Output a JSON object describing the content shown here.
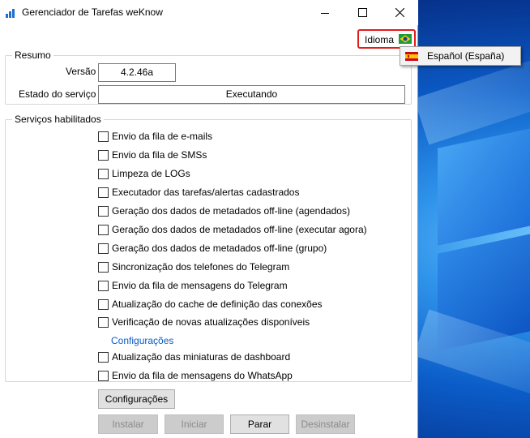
{
  "window": {
    "title": "Gerenciador de Tarefas weKnow",
    "minimize_icon": "minimize-icon",
    "maximize_icon": "maximize-icon",
    "close_icon": "close-icon"
  },
  "language": {
    "label": "Idioma",
    "current_flag": "brazil-flag-icon",
    "menu": {
      "items": [
        {
          "label": "Español (España)",
          "flag": "spain-flag-icon"
        }
      ]
    }
  },
  "summary": {
    "title": "Resumo",
    "version_label": "Versão",
    "version_value": "4.2.46a",
    "status_label": "Estado do serviço",
    "status_value": "Executando"
  },
  "services": {
    "title": "Serviços habilitados",
    "items": [
      {
        "label": "Envio da fila de e-mails",
        "checked": false
      },
      {
        "label": "Envio da fila de SMSs",
        "checked": false
      },
      {
        "label": "Limpeza de LOGs",
        "checked": false
      },
      {
        "label": "Executador das tarefas/alertas cadastrados",
        "checked": false
      },
      {
        "label": "Geração dos dados de metadados off-line (agendados)",
        "checked": false
      },
      {
        "label": "Geração dos dados de metadados off-line (executar agora)",
        "checked": false
      },
      {
        "label": "Geração dos dados de metadados off-line (grupo)",
        "checked": false
      },
      {
        "label": "Sincronização dos telefones do Telegram",
        "checked": false
      },
      {
        "label": "Envio da fila de mensagens do Telegram",
        "checked": false
      },
      {
        "label": "Atualização do cache de definição das conexões",
        "checked": false
      },
      {
        "label": "Verificação de novas atualizações disponíveis",
        "checked": false
      },
      {
        "label": "Atualização das miniaturas de dashboard",
        "checked": false
      },
      {
        "label": "Envio da fila de mensagens do WhatsApp",
        "checked": false
      }
    ],
    "config_link": "Configurações"
  },
  "buttons": {
    "settings": "Configurações",
    "install": "Instalar",
    "start": "Iniciar",
    "stop": "Parar",
    "uninstall": "Desinstalar"
  },
  "colors": {
    "highlight_border": "#e31b1b",
    "link": "#0a5bc4",
    "desktop_accent": "#0b5cc8"
  }
}
